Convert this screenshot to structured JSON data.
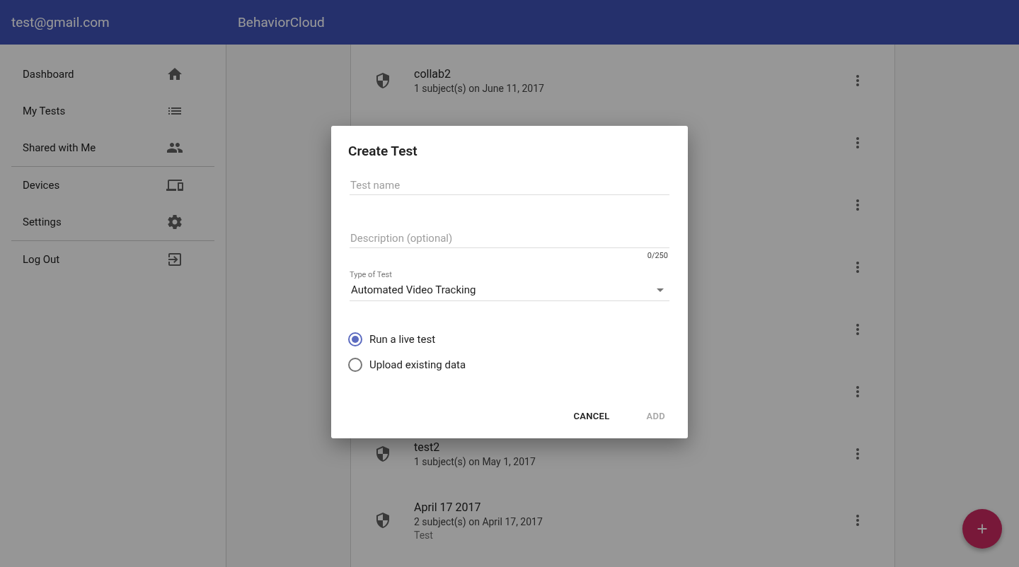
{
  "header": {
    "account": "test@gmail.com",
    "app_title": "BehaviorCloud"
  },
  "sidebar": {
    "sections": [
      {
        "items": [
          {
            "label": "Dashboard"
          },
          {
            "label": "My Tests"
          },
          {
            "label": "Shared with Me"
          }
        ]
      },
      {
        "items": [
          {
            "label": "Devices"
          },
          {
            "label": "Settings"
          }
        ]
      },
      {
        "items": [
          {
            "label": "Log Out"
          }
        ]
      }
    ]
  },
  "tests": [
    {
      "kind": "test",
      "title": "collab2",
      "subtitle": "1 subject(s) on June 11, 2017"
    },
    {
      "kind": "covered"
    },
    {
      "kind": "covered"
    },
    {
      "kind": "covered"
    },
    {
      "kind": "covered"
    },
    {
      "kind": "covered"
    },
    {
      "kind": "test",
      "title": "test2",
      "subtitle": "1 subject(s) on May 1, 2017"
    },
    {
      "kind": "test",
      "title": "April 17 2017",
      "subtitle": "2 subject(s) on April 17, 2017",
      "note": "Test"
    }
  ],
  "dialog": {
    "title": "Create Test",
    "name_field": {
      "placeholder": "Test name"
    },
    "description_field": {
      "placeholder": "Description (optional)",
      "counter": "0/250"
    },
    "type_select": {
      "label": "Type of Test",
      "value": "Automated Video Tracking"
    },
    "options": [
      {
        "label": "Run a live test",
        "selected": true
      },
      {
        "label": "Upload existing data",
        "selected": false
      }
    ],
    "buttons": [
      {
        "label": "CANCEL",
        "disabled": false
      },
      {
        "label": "ADD",
        "disabled": true
      }
    ]
  }
}
